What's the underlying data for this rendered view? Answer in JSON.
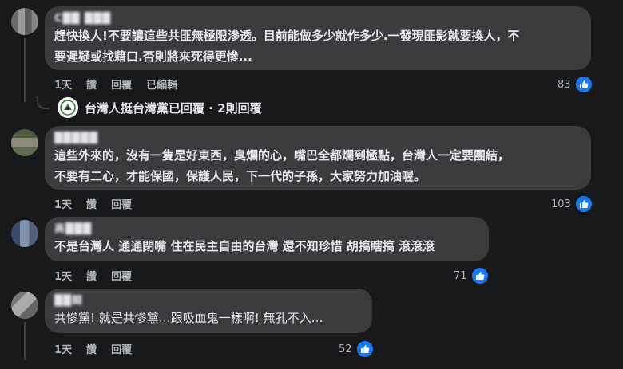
{
  "comments": [
    {
      "author": "C██ ███",
      "lines": [
        "趕快換人!不要讓這些共匪無極限滲透。目前能做多少就作多少.一發現匪影就要換人，不",
        "要遲疑或找藉口.否則將來死得更慘..."
      ],
      "actions": [
        "1天",
        "讚",
        "回覆",
        "已編輯"
      ],
      "likes": "83"
    },
    {
      "author": "█████",
      "lines": [
        "這些外來的，沒有一隻是好東西，臭爛的心，嘴巴全都爛到極點，台灣人一定要團結，",
        "不要有二心，才能保國，保護人民，下一代的子孫，大家努力加油喔。"
      ],
      "actions": [
        "1天",
        "讚",
        "回覆"
      ],
      "likes": "103"
    },
    {
      "author": "高███",
      "lines": [
        "不是台灣人 通通閉嘴 住在民主自由的台灣 還不知珍惜 胡搞瞎搞 滾滾滾"
      ],
      "actions": [
        "1天",
        "讚",
        "回覆"
      ],
      "likes": "71"
    },
    {
      "author": "██闘",
      "lines": [
        "共慘黨! 就是共慘黨…跟吸血鬼一樣啊! 無孔不入…"
      ],
      "actions": [
        "1天",
        "讚",
        "回覆"
      ],
      "likes": "52"
    }
  ],
  "reply_summary": {
    "text": "台灣人挺台灣黨已回覆 · 2則回覆"
  },
  "colors": {
    "background": "#18191a",
    "bubble": "#3a3b3c",
    "like_blue": "#1877f2"
  }
}
